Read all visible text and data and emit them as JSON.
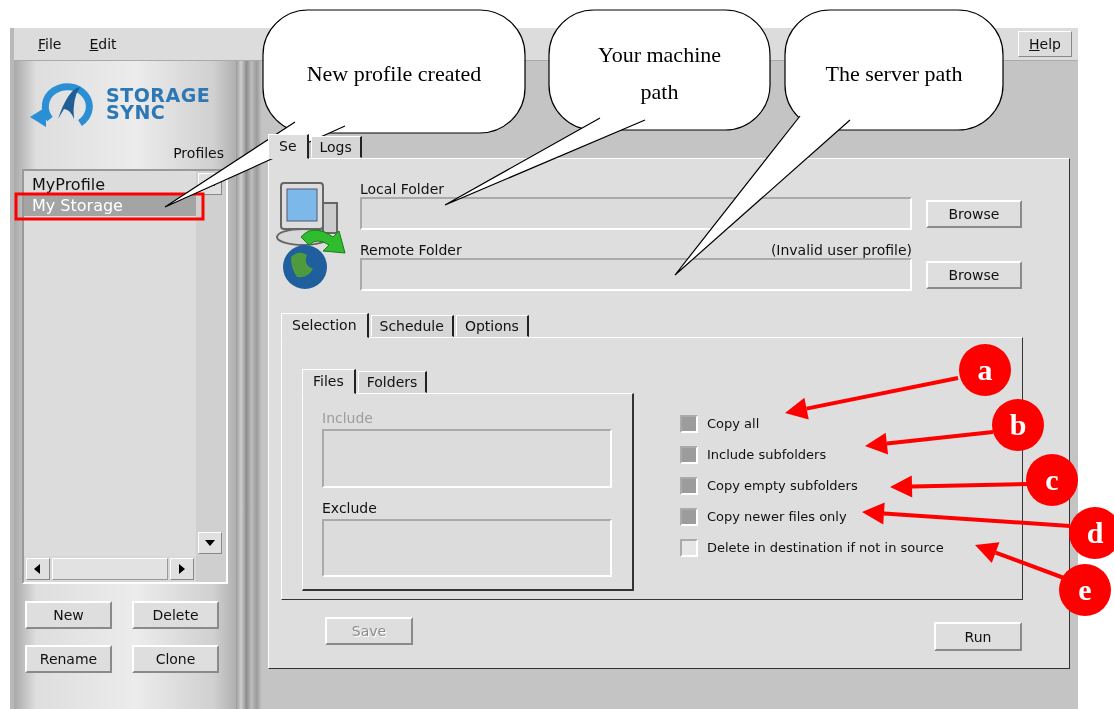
{
  "menu": {
    "left": [
      {
        "label": "File"
      },
      {
        "label": "Edit"
      }
    ],
    "right": [
      {
        "label": "Help"
      }
    ]
  },
  "logo": {
    "line1": "STORAGE",
    "line2": "SYNC"
  },
  "profiles": {
    "label": "Profiles",
    "items": [
      {
        "name": "MyProfile",
        "selected": false
      },
      {
        "name": "My Storage",
        "selected": true
      }
    ],
    "buttons": [
      "New",
      "Delete",
      "Rename",
      "Clone"
    ]
  },
  "main_tabs": [
    {
      "label": "Se",
      "selected": true
    },
    {
      "label": "Logs",
      "selected": false
    }
  ],
  "local_folder": {
    "label": "Local Folder",
    "button": "Browse"
  },
  "remote_folder": {
    "label": "Remote Folder",
    "note": "(Invalid user profile)",
    "button": "Browse"
  },
  "sub_tabs": [
    {
      "label": "Selection",
      "selected": true
    },
    {
      "label": "Schedule",
      "selected": false
    },
    {
      "label": "Options",
      "selected": false
    }
  ],
  "filter_tabs": [
    {
      "label": "Files",
      "selected": true
    },
    {
      "label": "Folders",
      "selected": false
    }
  ],
  "include": {
    "label": "Include",
    "disabled": true
  },
  "exclude": {
    "label": "Exclude",
    "disabled": false
  },
  "options": [
    {
      "label": "Copy all",
      "checked": true
    },
    {
      "label": "Include subfolders",
      "checked": true
    },
    {
      "label": "Copy empty subfolders",
      "checked": true
    },
    {
      "label": "Copy newer files only",
      "checked": true
    },
    {
      "label": "Delete in destination if not in source",
      "checked": false
    }
  ],
  "save_button": {
    "label": "Save",
    "disabled": true
  },
  "run_button": {
    "label": "Run",
    "disabled": false
  },
  "annotations": {
    "callouts": [
      {
        "text": "New profile created"
      },
      {
        "text": "Your machine path"
      },
      {
        "text": "The server path"
      }
    ],
    "markers": [
      {
        "letter": "a"
      },
      {
        "letter": "b"
      },
      {
        "letter": "c"
      },
      {
        "letter": "d"
      },
      {
        "letter": "e"
      }
    ]
  }
}
